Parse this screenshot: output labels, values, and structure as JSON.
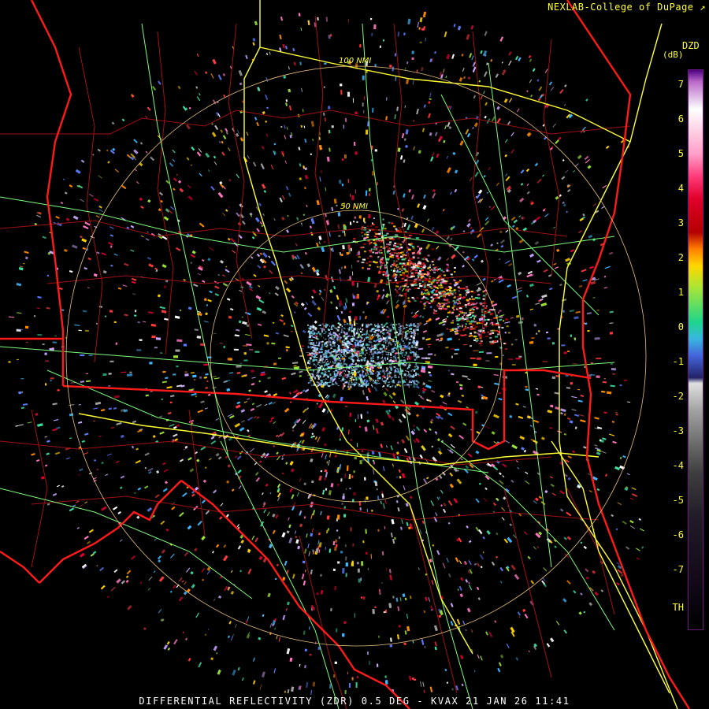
{
  "credit": "NEXLAB-College of DuPage",
  "credit_icon": "diagonal-arrow-icon",
  "legend": {
    "product": "DZD",
    "units": "(dB)",
    "ticks": [
      "7",
      "6",
      "5",
      "4",
      "3",
      "2",
      "1",
      "0",
      "-1",
      "-2",
      "-3",
      "-4",
      "-5",
      "-6",
      "-7",
      "TH"
    ]
  },
  "range_rings": {
    "inner_label": "50 NMI",
    "outer_label": "100 NMI"
  },
  "footer": "DIFFERENTIAL REFLECTIVITY (ZDR) 0.5 DEG - KVAX 21 JAN 26 11:41",
  "colors": {
    "background": "#000000",
    "state_border": "#ff1a1a",
    "county_border": "#a01010",
    "interstate": "#ffff33",
    "highway": "#7cfc7c",
    "range_ring": "#e8c07a",
    "text": "#ffff33"
  }
}
